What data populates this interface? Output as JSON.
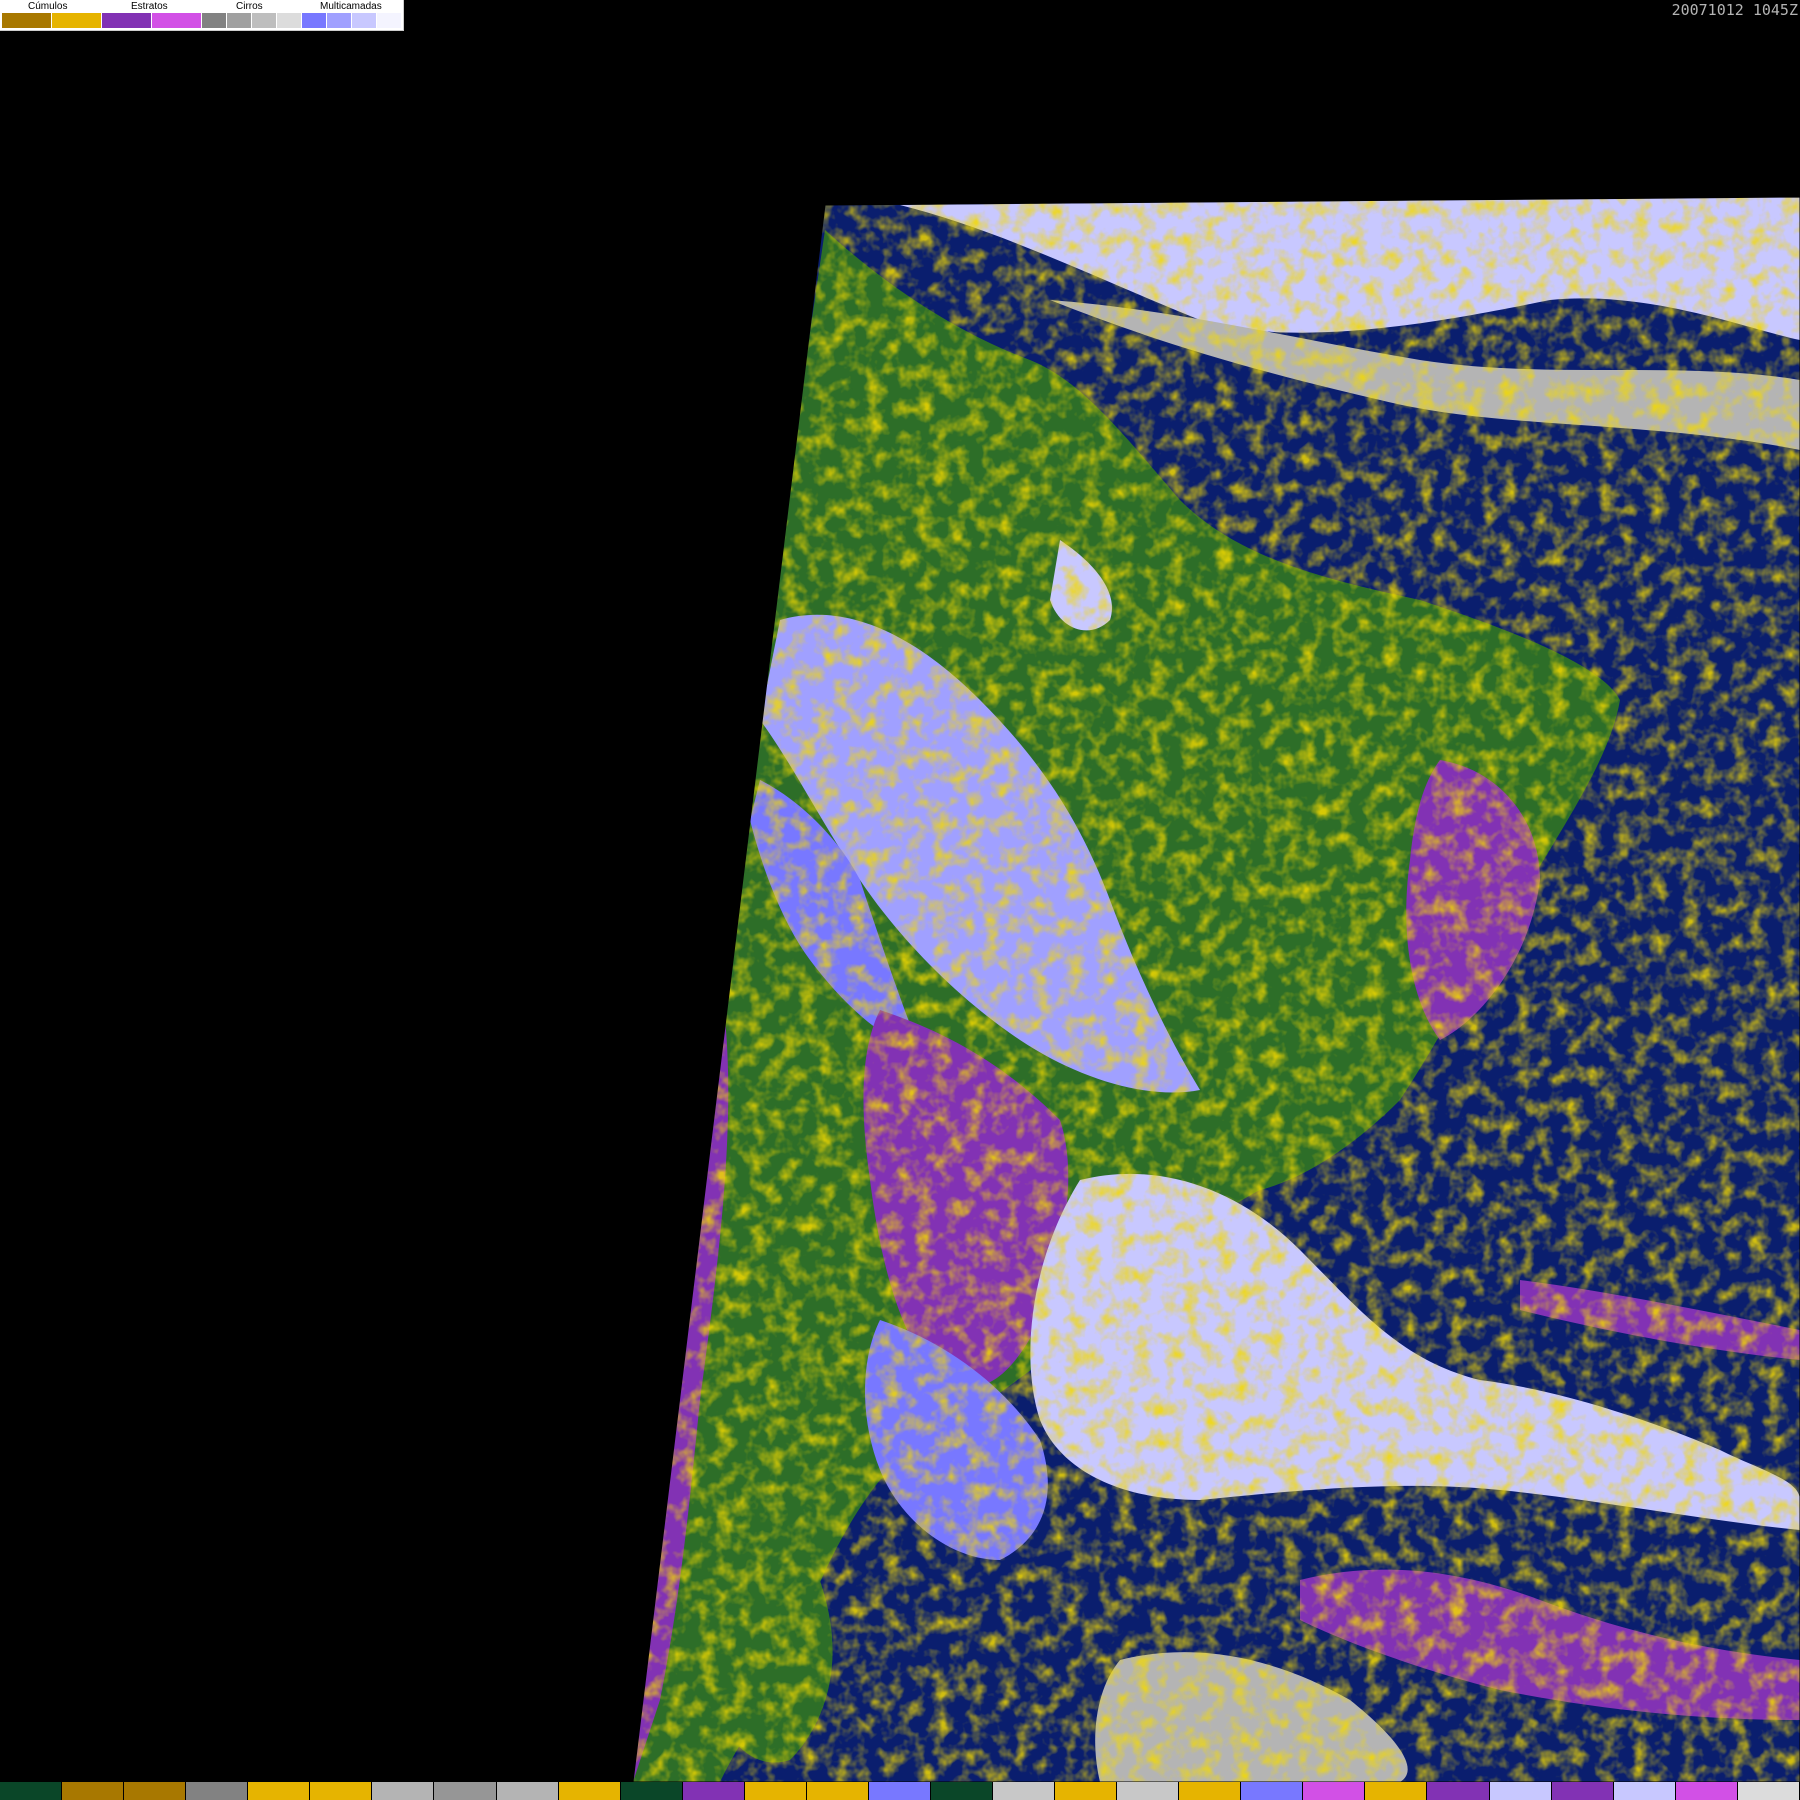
{
  "legend": {
    "groups": [
      {
        "label": "Cúmulos",
        "swatches": [
          "#a87800",
          "#e6b400"
        ]
      },
      {
        "label": "Estratos",
        "swatches": [
          "#8232b4",
          "#d250e6"
        ]
      },
      {
        "label": "Cirros",
        "swatches": [
          "#828282",
          "#a0a0a0",
          "#bebebe",
          "#dcdcdc"
        ]
      },
      {
        "label": "Multicamadas",
        "swatches": [
          "#7878ff",
          "#a0a0ff",
          "#c8c8ff",
          "#f4f4ff"
        ]
      }
    ]
  },
  "timestamp": "20071012 1045Z",
  "colors": {
    "ocean": "#0a1e6e",
    "land": "#2d6e28",
    "land_dark": "#1e5a1e",
    "cumulus_dark": "#a87800",
    "cumulus_light": "#e6b400",
    "stratus_dark": "#8232b4",
    "stratus_light": "#d250e6",
    "cirrus": "#b4b4b4",
    "multilayer_dark": "#7878ff",
    "multilayer_mid": "#a0a0ff",
    "multilayer_light": "#c8c8ff",
    "background": "#000000"
  },
  "bottom_bar": [
    "#0a4628",
    "#a87800",
    "#a87800",
    "#828282",
    "#e6b400",
    "#e6b400",
    "#b4b4b4",
    "#969696",
    "#b4b4b4",
    "#e6b400",
    "#0a4628",
    "#8232b4",
    "#e6b400",
    "#e6b400",
    "#7878ff",
    "#0a4628",
    "#c8c8c8",
    "#e6b400",
    "#c8c8c8",
    "#e6b400",
    "#7878ff",
    "#d250e6",
    "#e6b400",
    "#8232b4",
    "#c8c8ff",
    "#8232b4",
    "#c8c8ff",
    "#d250e6",
    "#dcdcdc"
  ]
}
